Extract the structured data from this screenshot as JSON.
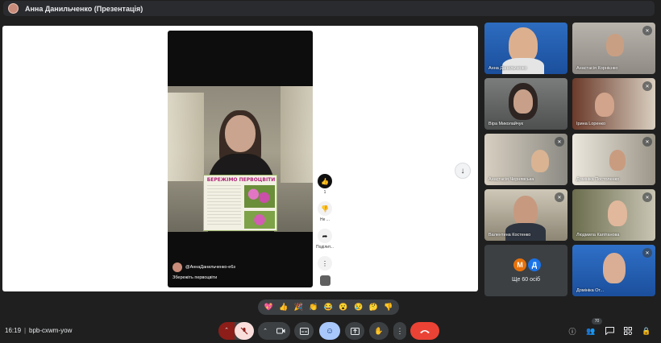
{
  "presentation": {
    "title": "Анна Данильченко (Презентація)"
  },
  "shared_video": {
    "poster_title": "БЕРЕЖІМО ПЕРВОЦВІТИ",
    "channel_name": "@АннаДанильченко-е6з",
    "caption": "Збережіть первоцвіти",
    "actions": [
      {
        "icon": "thumbs-up-icon",
        "label": "1"
      },
      {
        "icon": "thumbs-down-icon",
        "label": "Не ..."
      },
      {
        "icon": "share-icon",
        "label": "Поділит..."
      },
      {
        "icon": "more-icon",
        "label": ""
      }
    ]
  },
  "participants": [
    {
      "name": "Анна Данильченко",
      "muted": false
    },
    {
      "name": "Анастасія Корнієнко",
      "muted": true
    },
    {
      "name": "Віра Миколайчук",
      "muted": false
    },
    {
      "name": "Ірина Loренко",
      "muted": true
    },
    {
      "name": "Анастасія Чернявська",
      "muted": true
    },
    {
      "name": "Домініка Постоленко",
      "muted": true
    },
    {
      "name": "Валентина Костенко",
      "muted": true
    },
    {
      "name": "Людмила Капітанова",
      "muted": true
    },
    {
      "name": "Домініка От...",
      "muted": true
    }
  ],
  "more_participants": {
    "label": "Ще 60 осіб",
    "avatars": [
      {
        "letter": "М",
        "color": "#e8710a"
      },
      {
        "letter": "Д",
        "color": "#1a73e8"
      }
    ]
  },
  "reactions": [
    "💖",
    "👍",
    "🎉",
    "👏",
    "😂",
    "😮",
    "😢",
    "🤔",
    "👎"
  ],
  "bottom_bar": {
    "time": "16:19",
    "separator": "|",
    "meeting_code": "bpb-cxwm-yow",
    "people_count": "70"
  },
  "colors": {
    "background": "#1f1f1f",
    "leave_red": "#ea4335",
    "mic_muted": "#f9dedc",
    "emoji_blue": "#a8c7fa",
    "control_grey": "#3c4043"
  }
}
